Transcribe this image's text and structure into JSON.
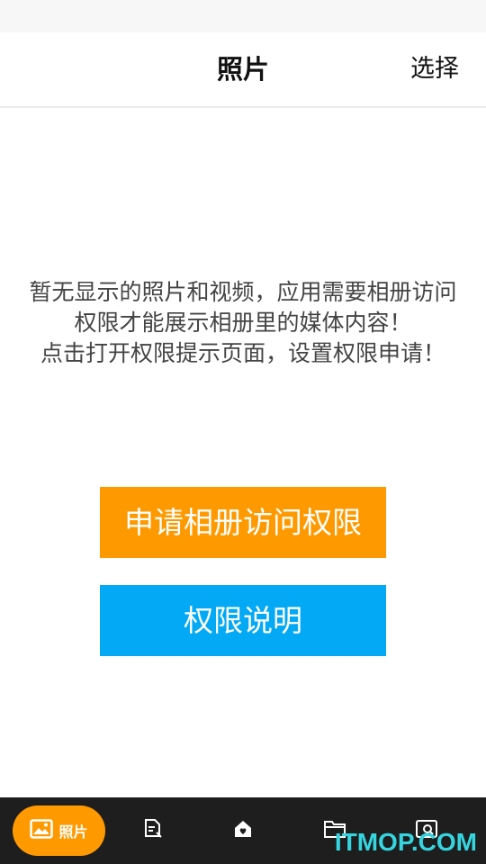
{
  "header": {
    "title": "照片",
    "select_label": "选择"
  },
  "message": {
    "line1": "暂无显示的照片和视频，应用需要相册访问权限才能展示相册里的媒体内容！",
    "line2": "点击打开权限提示页面，设置权限申请！"
  },
  "buttons": {
    "request_label": "申请相册访问权限",
    "explain_label": "权限说明"
  },
  "bottom_nav": {
    "items": [
      {
        "label": "照片",
        "icon": "image-icon",
        "active": true
      },
      {
        "label": "",
        "icon": "document-edit-icon",
        "active": false
      },
      {
        "label": "",
        "icon": "home-heart-icon",
        "active": false
      },
      {
        "label": "",
        "icon": "folder-icon",
        "active": false
      },
      {
        "label": "",
        "icon": "search-icon",
        "active": false
      }
    ]
  },
  "colors": {
    "accent_orange": "#ff9900",
    "accent_blue": "#03a9f4",
    "nav_background": "#1e1e1e",
    "watermark": "#35d5e0"
  },
  "watermark": "ITMOP.COM"
}
